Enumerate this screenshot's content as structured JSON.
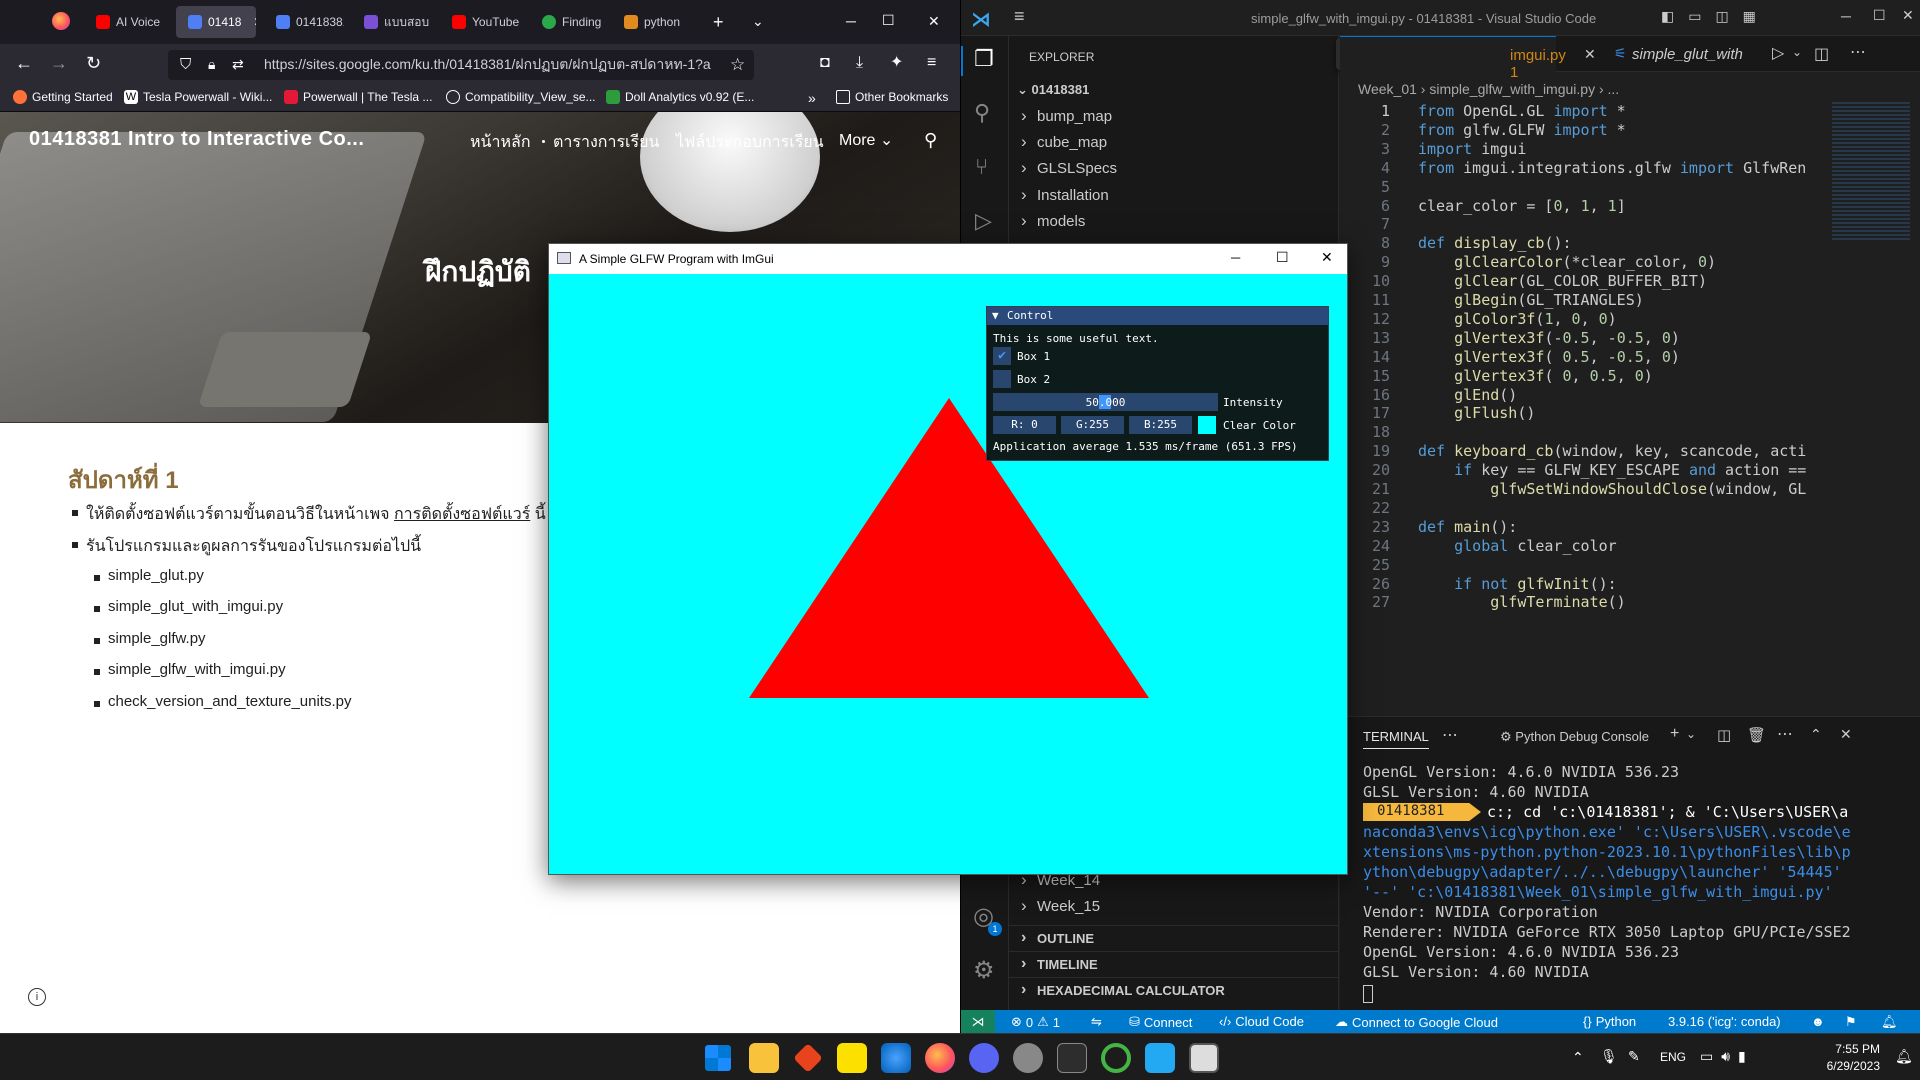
{
  "firefox": {
    "tabs": [
      "AI Voice",
      "01418",
      "01418381",
      "แบบสอบ",
      "YouTube",
      "Finding",
      "python"
    ],
    "url": "https://sites.google.com/ku.th/01418381/ฝกปฏบต/ฝกปฏบต-สปดาหท-1?a",
    "bookmarks": [
      "Getting Started",
      "Tesla Powerwall - Wiki...",
      "Powerwall | The Tesla ...",
      "Compatibility_View_se...",
      "Doll Analytics v0.92 (E...",
      "Other Bookmarks"
    ],
    "site": {
      "title": "01418381 Intro to Interactive Co...",
      "nav": [
        "หน้าหลัก",
        "ตารางการเรียน",
        "ไฟล์ประกอบการเรียน",
        "More"
      ],
      "hero": "ฝึกปฏิบัติ",
      "week": "สัปดาห์ที่ 1",
      "bullet1": "ให้ติดตั้งซอฟต์แวร์ตามขั้นตอนวิธีในหน้าเพจ",
      "bullet1_link": "การติดตั้งซอฟต์แวร์",
      "bullet1_tail": "นี้",
      "bullet2": "รันโปรแกรมและดูผลการรันของโปรแกรมต่อไปนี้",
      "files": [
        "simple_glut.py",
        "simple_glut_with_imgui.py",
        "simple_glfw.py",
        "simple_glfw_with_imgui.py",
        "check_version_and_texture_units.py"
      ]
    }
  },
  "vscode": {
    "title": "simple_glfw_with_imgui.py - 01418381 - Visual Studio Code",
    "explorer": "EXPLORER",
    "root": "01418381",
    "folders": [
      "bump_map",
      "cube_map",
      "GLSLSpecs",
      "Installation",
      "models"
    ],
    "folders_bottom": [
      "Week_14",
      "Week_15"
    ],
    "sections": [
      "OUTLINE",
      "TIMELINE",
      "HEXADECIMAL CALCULATOR"
    ],
    "tab1": "imgui.py 1",
    "tab2": "simple_glut_with",
    "breadcrumb": "Week_01 › simple_glfw_with_imgui.py › ...",
    "gutter_badge": "1",
    "code": [
      "from OpenGL.GL import *",
      "from glfw.GLFW import *",
      "import imgui",
      "from imgui.integrations.glfw import GlfwRen",
      "",
      "clear_color = [0, 1, 1]",
      "",
      "def display_cb():",
      "    glClearColor(*clear_color, 0)",
      "    glClear(GL_COLOR_BUFFER_BIT)",
      "    glBegin(GL_TRIANGLES)",
      "    glColor3f(1, 0, 0)",
      "    glVertex3f(-0.5, -0.5, 0)",
      "    glVertex3f( 0.5, -0.5, 0)",
      "    glVertex3f( 0, 0.5, 0)",
      "    glEnd()",
      "    glFlush()",
      "",
      "def keyboard_cb(window, key, scancode, acti",
      "    if key == GLFW_KEY_ESCAPE and action ==",
      "        glfwSetWindowShouldClose(window, GL",
      "",
      "def main():",
      "    global clear_color",
      "",
      "    if not glfwInit():",
      "        glfwTerminate()"
    ],
    "terminal": {
      "tab": "TERMINAL",
      "console": "Python Debug Console",
      "prompt": "01418381",
      "lines": [
        "OpenGL Version: 4.6.0 NVIDIA 536.23",
        "GLSL Version: 4.60 NVIDIA",
        "",
        "naconda3\\envs\\icg\\python.exe' 'c:\\Users\\USER\\.vscode\\e",
        "xtensions\\ms-python.python-2023.10.1\\pythonFiles\\lib\\p",
        "ython\\debugpy\\adapter/../..\\debugpy\\launcher' '54445'",
        "'--' 'c:\\01418381\\Week_01\\simple_glfw_with_imgui.py'",
        "Vendor: NVIDIA Corporation",
        "Renderer: NVIDIA GeForce RTX 3050 Laptop GPU/PCIe/SSE2",
        "OpenGL Version: 4.6.0 NVIDIA 536.23",
        "GLSL Version: 4.60 NVIDIA"
      ],
      "cmd": "c:; cd 'c:\\01418381'; & 'C:\\Users\\USER\\a"
    },
    "status": {
      "problems": "0",
      "warnings": "1",
      "connect": "Connect",
      "cloud_code": "Cloud Code",
      "google_cloud": "Connect to Google Cloud",
      "python": "Python",
      "python_ver": "3.9.16 ('icg': conda)"
    },
    "accounts_badge": "1"
  },
  "glfw": {
    "title": "A Simple GLFW Program with ImGui",
    "clear_color": "#00ffff",
    "triangle_color": "#ff0000",
    "control": {
      "header": "Control",
      "text": "This is some useful text.",
      "box1": "Box 1",
      "box2": "Box 2",
      "intensity_value": "50.000",
      "intensity_label": "Intensity",
      "r": "R:  0",
      "g": "G:255",
      "b": "B:255",
      "clear_label": "Clear Color",
      "fps": "Application average 1.535 ms/frame (651.3 FPS)"
    }
  },
  "taskbar": {
    "lang": "ENG",
    "time": "7:55 PM",
    "date": "6/29/2023"
  }
}
